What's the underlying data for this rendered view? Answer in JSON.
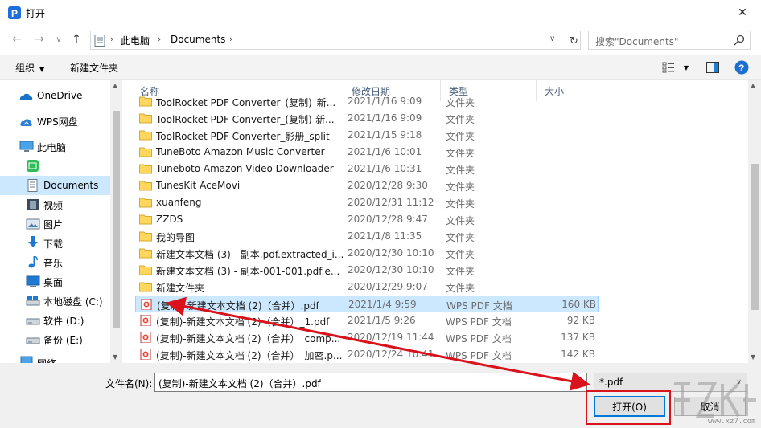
{
  "window": {
    "title": "打开",
    "close_symbol": "✕"
  },
  "nav": {
    "back": "←",
    "forward": "→",
    "recent": "∨",
    "up": "↑",
    "address": {
      "root_sep": "›",
      "seg1": "此电脑",
      "sep": "›",
      "seg2": "Documents",
      "sep2": "›",
      "dropdown": "∨",
      "refresh": "↻"
    },
    "search": {
      "placeholder": "搜索\"Documents\""
    }
  },
  "toolbar": {
    "organize": "组织",
    "organize_caret": "▼",
    "new_folder": "新建文件夹",
    "view_caret": "▼",
    "help": "?"
  },
  "sidebar": {
    "items": [
      {
        "label": "OneDrive",
        "icon": "onedrive-icon"
      },
      {
        "label": "WPS网盘",
        "icon": "wps-cloud-icon"
      },
      {
        "label": "此电脑",
        "icon": "computer-icon"
      },
      {
        "label": "",
        "icon": "wps-app-icon"
      },
      {
        "label": "Documents",
        "icon": "documents-icon",
        "selected": true
      },
      {
        "label": "视频",
        "icon": "video-icon"
      },
      {
        "label": "图片",
        "icon": "pictures-icon"
      },
      {
        "label": "下载",
        "icon": "download-icon"
      },
      {
        "label": "音乐",
        "icon": "music-icon"
      },
      {
        "label": "桌面",
        "icon": "desktop-icon"
      },
      {
        "label": "本地磁盘 (C:)",
        "icon": "local-disk-icon"
      },
      {
        "label": "软件 (D:)",
        "icon": "drive-icon"
      },
      {
        "label": "备份 (E:)",
        "icon": "drive-icon"
      },
      {
        "label": "网络",
        "icon": "network-icon"
      }
    ]
  },
  "columns": {
    "name": "名称",
    "date": "修改日期",
    "type": "类型",
    "size": "大小",
    "sort_arrow": "^"
  },
  "files": [
    {
      "name": "ToolRocket PDF Converter_(复制)_新...",
      "date": "2021/1/16 9:09",
      "type": "文件夹",
      "size": "",
      "kind": "folder"
    },
    {
      "name": "ToolRocket PDF Converter_(复制)-新...",
      "date": "2021/1/16 9:09",
      "type": "文件夹",
      "size": "",
      "kind": "folder"
    },
    {
      "name": "ToolRocket PDF Converter_影册_split",
      "date": "2021/1/15 9:18",
      "type": "文件夹",
      "size": "",
      "kind": "folder"
    },
    {
      "name": "TuneBoto Amazon Music Converter",
      "date": "2021/1/6 10:01",
      "type": "文件夹",
      "size": "",
      "kind": "folder"
    },
    {
      "name": "Tuneboto Amazon Video Downloader",
      "date": "2021/1/6 10:31",
      "type": "文件夹",
      "size": "",
      "kind": "folder"
    },
    {
      "name": "TunesKit AceMovi",
      "date": "2020/12/28 9:30",
      "type": "文件夹",
      "size": "",
      "kind": "folder"
    },
    {
      "name": "xuanfeng",
      "date": "2020/12/31 11:12",
      "type": "文件夹",
      "size": "",
      "kind": "folder"
    },
    {
      "name": "ZZDS",
      "date": "2020/12/28 9:47",
      "type": "文件夹",
      "size": "",
      "kind": "folder"
    },
    {
      "name": "我的导图",
      "date": "2021/1/8 11:35",
      "type": "文件夹",
      "size": "",
      "kind": "folder"
    },
    {
      "name": "新建文本文档 (3) - 副本.pdf.extracted_i...",
      "date": "2020/12/30 10:10",
      "type": "文件夹",
      "size": "",
      "kind": "folder"
    },
    {
      "name": "新建文本文档 (3) - 副本-001-001.pdf.e...",
      "date": "2020/12/30 10:10",
      "type": "文件夹",
      "size": "",
      "kind": "folder"
    },
    {
      "name": "新建文件夹",
      "date": "2020/12/29 9:07",
      "type": "文件夹",
      "size": "",
      "kind": "folder"
    },
    {
      "name": "(复制)-新建文本文档 (2)（合并）.pdf",
      "date": "2021/1/4 9:59",
      "type": "WPS PDF 文档",
      "size": "160 KB",
      "kind": "pdf",
      "selected": true
    },
    {
      "name": "(复制)-新建文本文档 (2)（合并）_1.pdf",
      "date": "2021/1/5 9:26",
      "type": "WPS PDF 文档",
      "size": "92 KB",
      "kind": "pdf"
    },
    {
      "name": "(复制)-新建文本文档 (2)（合并）_comp...",
      "date": "2020/12/19 11:44",
      "type": "WPS PDF 文档",
      "size": "137 KB",
      "kind": "pdf"
    },
    {
      "name": "(复制)-新建文本文档 (2)（合并）_加密.p...",
      "date": "2020/12/24 10:41",
      "type": "WPS PDF 文档",
      "size": "142 KB",
      "kind": "pdf"
    }
  ],
  "bottom": {
    "filename_label": "文件名(N):",
    "filename_value": "(复制)-新建文本文档 (2)（合并）.pdf",
    "filename_dd": "∨",
    "filter_value": "*.pdf",
    "filter_dd": "∨",
    "open_button": "打开(O)",
    "cancel_button": "取消"
  },
  "watermark": {
    "text": "www.xz7.com"
  },
  "colors": {
    "accent": "#0078d7",
    "selection": "#cce8ff",
    "annotation_red": "#d9121b",
    "folder": "#ffd75e"
  }
}
